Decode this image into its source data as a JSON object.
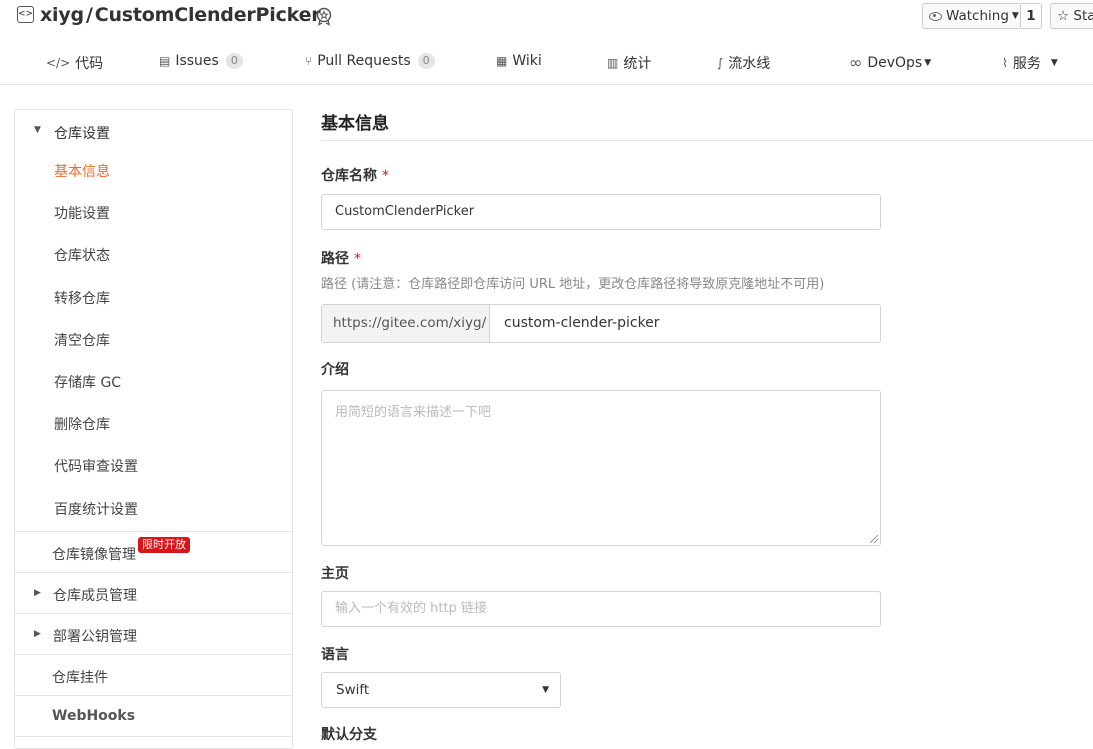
{
  "header": {
    "owner": "xiyg",
    "separator": "/",
    "repo_name": "CustomClenderPicker",
    "watch_label": "Watching",
    "watch_count": "1",
    "star_label": "Sta"
  },
  "nav": {
    "tabs": [
      {
        "label": "代码",
        "icon": "code-icon"
      },
      {
        "label": "Issues",
        "icon": "issues-icon",
        "count": "0"
      },
      {
        "label": "Pull Requests",
        "icon": "pull-request-icon",
        "count": "0"
      },
      {
        "label": "Wiki",
        "icon": "wiki-icon"
      },
      {
        "label": "统计",
        "icon": "bar-chart-icon"
      },
      {
        "label": "流水线",
        "icon": "pipeline-icon"
      },
      {
        "label": "DevOps",
        "icon": "infinity-icon"
      },
      {
        "label": "服务",
        "icon": "pulse-icon"
      }
    ]
  },
  "sidebar": {
    "group_title": "仓库设置",
    "items": [
      "基本信息",
      "功能设置",
      "仓库状态",
      "转移仓库",
      "清空仓库",
      "存储库 GC",
      "删除仓库",
      "代码审查设置",
      "百度统计设置"
    ],
    "mirror": "仓库镜像管理",
    "promo": "限时开放",
    "members": "仓库成员管理",
    "deploy_keys": "部署公钥管理",
    "plugins": "仓库挂件",
    "webhooks": "WebHooks"
  },
  "form": {
    "title": "基本信息",
    "name_label": "仓库名称",
    "required_mark": "*",
    "name_value": "CustomClenderPicker",
    "path_label": "路径",
    "path_hint": "路径 (请注意：仓库路径即仓库访问 URL 地址，更改仓库路径将导致原克隆地址不可用)",
    "path_prefix": "https://gitee.com/xiyg/",
    "path_value": "custom-clender-picker",
    "intro_label": "介绍",
    "intro_placeholder": "用简短的语言来描述一下吧",
    "homepage_label": "主页",
    "homepage_placeholder": "输入一个有效的 http 链接",
    "language_label": "语言",
    "language_value": "Swift",
    "default_branch_label": "默认分支"
  },
  "colors": {
    "active": "#f06a2a",
    "promo": "#d9151c"
  }
}
